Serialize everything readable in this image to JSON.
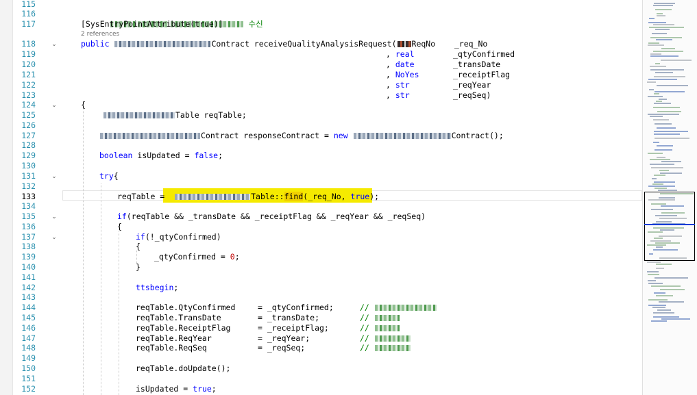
{
  "editor": {
    "current_line": "133",
    "codelens_text": "2 references",
    "colors": {
      "keyword": "#0000ff",
      "comment": "#008000",
      "line_number": "#2b91af",
      "find_highlight": "#f5ea00",
      "caret_marker": "#0a3cd6"
    },
    "line_numbers": [
      "115",
      "116",
      "117",
      "118",
      "119",
      "120",
      "121",
      "122",
      "123",
      "124",
      "125",
      "126",
      "127",
      "128",
      "129",
      "130",
      "131",
      "132",
      "133",
      "134",
      "135",
      "136",
      "137",
      "138",
      "139",
      "140",
      "141",
      "142",
      "143",
      "144",
      "145",
      "146",
      "147",
      "148",
      "149",
      "150",
      "151",
      "152"
    ],
    "fold_icon": "chevron-down-icon",
    "lines": {
      "l116": {
        "suffix": "수신"
      },
      "l117": {
        "text": "[SysEntryPointAttribute(true)]"
      },
      "l118": {
        "kw": "public",
        "t1": "Contract receiveQualityAnalysisRequest(",
        "t2": "ReqNo",
        "t3": "_req_No"
      },
      "l119": {
        "c": ",",
        "kw": "real",
        "v": "_qtyConfirmed"
      },
      "l120": {
        "c": ",",
        "kw": "date",
        "v": "_transDate"
      },
      "l121": {
        "c": ",",
        "kw": "NoYes",
        "v": "_receiptFlag"
      },
      "l122": {
        "c": ",",
        "kw": "str",
        "v": "_reqYear"
      },
      "l123": {
        "c": ",",
        "kw": "str",
        "v": "_reqSeq)"
      },
      "l124": {
        "text": "{"
      },
      "l125": {
        "text": "Table reqTable;"
      },
      "l127": {
        "t1": "Contract responseContract = ",
        "kw": "new",
        "t2": "Contract();"
      },
      "l129": {
        "kw1": "boolean",
        "t1": " isUpdated = ",
        "kw2": "false",
        "t2": ";"
      },
      "l131": {
        "kw": "try",
        "t": "{"
      },
      "l133": {
        "t1": "reqTable = ",
        "t2": "Table::",
        "t3": "find",
        "t4": "(_req_No, ",
        "kw": "true",
        "t5": ");"
      },
      "l135": {
        "kw": "if",
        "t": "(reqTable && _transDate && _receiptFlag && _reqYear && _reqSeq)"
      },
      "l136": {
        "text": "{"
      },
      "l137": {
        "kw": "if",
        "t": "(!_qtyConfirmed)"
      },
      "l138": {
        "text": "{"
      },
      "l139": {
        "t1": "_qtyConfirmed = ",
        "n": "0",
        "t2": ";"
      },
      "l140": {
        "text": "}"
      },
      "l142": {
        "kw": "ttsbegin",
        "t": ";"
      },
      "l144": {
        "a": "reqTable.QtyConfirmed",
        "b": "= _qtyConfirmed;",
        "cm": "//"
      },
      "l145": {
        "a": "reqTable.TransDate",
        "b": "= _transDate;",
        "cm": "//"
      },
      "l146": {
        "a": "reqTable.ReceiptFlag",
        "b": "= _receiptFlag;",
        "cm": "//"
      },
      "l147": {
        "a": "reqTable.ReqYear",
        "b": "= _reqYear;",
        "cm": "//"
      },
      "l148": {
        "a": "reqTable.ReqSeq",
        "b": "= _reqSeq;",
        "cm": "//"
      },
      "l150": {
        "text": "reqTable.doUpdate();"
      },
      "l152": {
        "t1": "isUpdated = ",
        "kw": "true",
        "t2": ";"
      }
    }
  }
}
